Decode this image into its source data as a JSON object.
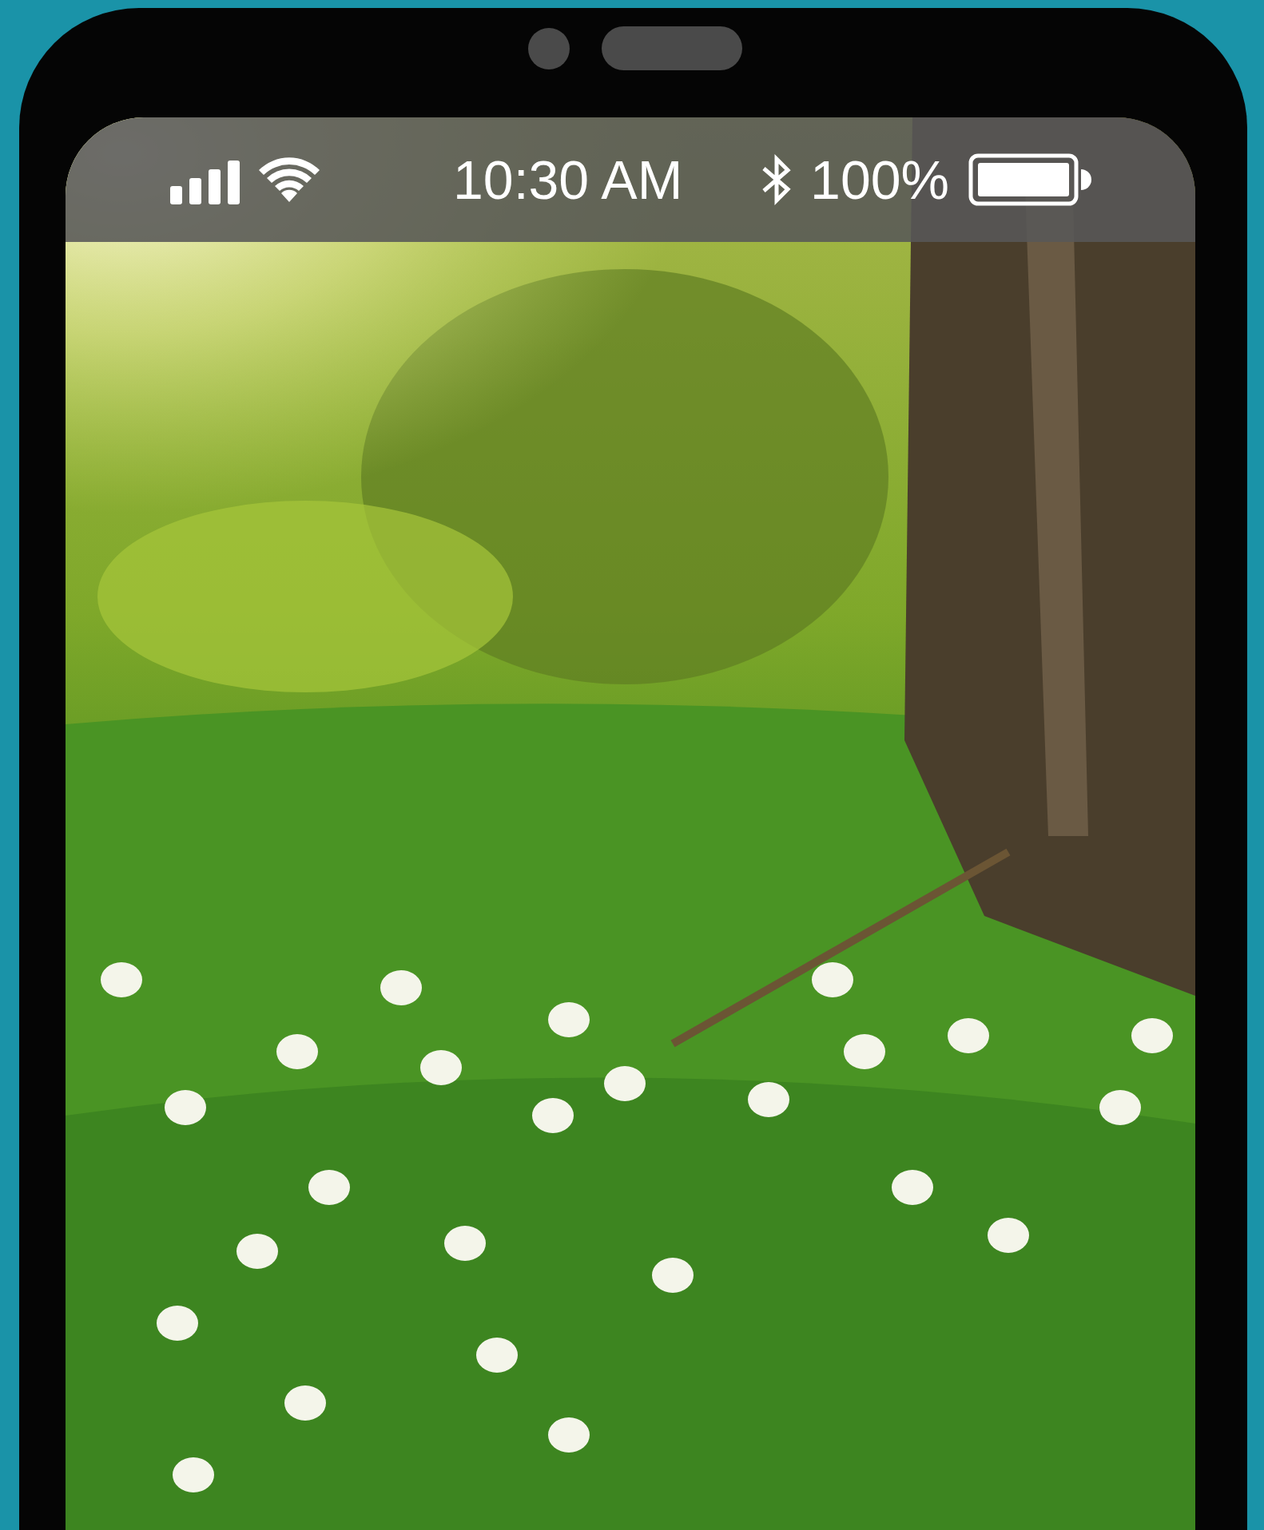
{
  "status_bar": {
    "time": "10:30 AM",
    "battery_percent": "100%"
  }
}
